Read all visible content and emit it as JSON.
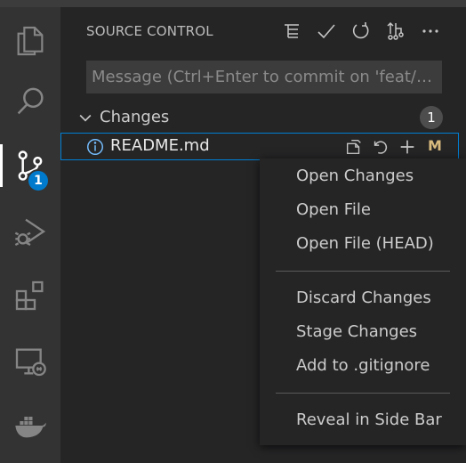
{
  "activity_bar": {
    "items": [
      {
        "name": "explorer",
        "icon": "files-icon"
      },
      {
        "name": "search",
        "icon": "search-icon"
      },
      {
        "name": "source-control",
        "icon": "source-control-icon",
        "badge": "1",
        "active": true
      },
      {
        "name": "run-debug",
        "icon": "run-debug-icon"
      },
      {
        "name": "extensions",
        "icon": "extensions-icon"
      },
      {
        "name": "remote-explorer",
        "icon": "remote-explorer-icon"
      },
      {
        "name": "docker",
        "icon": "docker-icon"
      }
    ]
  },
  "sidebar": {
    "title": "SOURCE CONTROL",
    "actions": [
      "view-as-tree-icon",
      "commit-check-icon",
      "refresh-icon",
      "pull-push-icon",
      "more-actions-icon"
    ],
    "commit_message": {
      "value": "",
      "placeholder": "Message (Ctrl+Enter to commit on 'feat/ch..."
    },
    "changes": {
      "label": "Changes",
      "count": "1",
      "files": [
        {
          "name": "README.md",
          "status": "M",
          "icon": "info-icon"
        }
      ]
    }
  },
  "context_menu": {
    "groups": [
      [
        "Open Changes",
        "Open File",
        "Open File (HEAD)"
      ],
      [
        "Discard Changes",
        "Stage Changes",
        "Add to .gitignore"
      ],
      [
        "Reveal in Side Bar"
      ]
    ]
  },
  "colors": {
    "accent": "#007acc",
    "focus_border": "#007fd4",
    "modified": "#d7ba7d",
    "activity_bg": "#333333",
    "sidebar_bg": "#252526"
  }
}
